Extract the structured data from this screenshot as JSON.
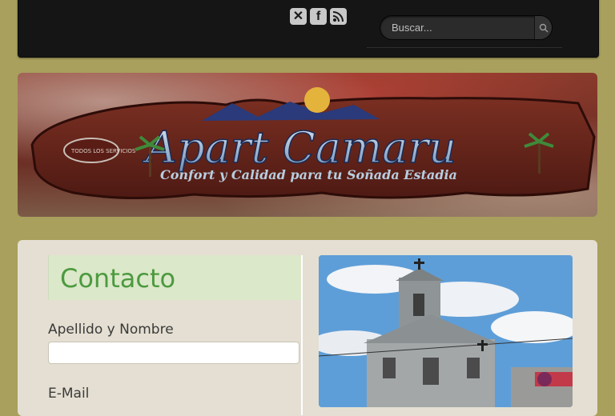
{
  "header": {
    "social": [
      {
        "icon": "x-icon",
        "glyph": "✕"
      },
      {
        "icon": "facebook-icon",
        "glyph": "f"
      },
      {
        "icon": "rss-icon",
        "glyph": "◉"
      }
    ],
    "search": {
      "placeholder": "Buscar..."
    }
  },
  "banner": {
    "title": "Apart Camaru",
    "tagline": "Confort y Calidad para tu Soñada Estadia",
    "badge": "TODOS LOS SERVICIOS"
  },
  "contact": {
    "heading": "Contacto",
    "name_label": "Apellido y Nombre",
    "email_label": "E-Mail"
  },
  "colors": {
    "page_bg": "#a8a05c",
    "heading_green": "#4c9a3f"
  }
}
